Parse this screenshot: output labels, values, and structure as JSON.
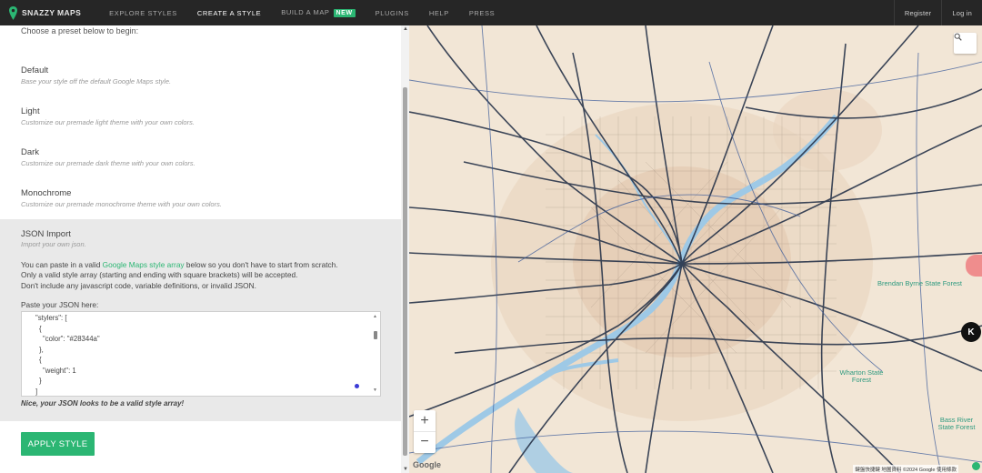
{
  "nav": {
    "brand": "SNAZZY MAPS",
    "items": [
      {
        "label": "EXPLORE STYLES"
      },
      {
        "label": "CREATE A STYLE"
      },
      {
        "label": "BUILD A MAP",
        "badge": "NEW"
      },
      {
        "label": "PLUGINS"
      },
      {
        "label": "HELP"
      },
      {
        "label": "PRESS"
      }
    ],
    "register": "Register",
    "login": "Log in"
  },
  "panel": {
    "intro": "Choose a preset below to begin:",
    "presets": [
      {
        "title": "Default",
        "desc": "Base your style off the default Google Maps style."
      },
      {
        "title": "Light",
        "desc": "Customize our premade light theme with your own colors."
      },
      {
        "title": "Dark",
        "desc": "Customize our premade dark theme with your own colors."
      },
      {
        "title": "Monochrome",
        "desc": "Customize our premade monochrome theme with your own colors."
      }
    ],
    "json_import": {
      "title": "JSON Import",
      "desc": "Import your own json.",
      "para_before_link": "You can paste in a valid ",
      "link": "Google Maps style array",
      "para_after_link": " below so you don't have to start from scratch.",
      "para_line2": "Only a valid style array (starting and ending with square brackets) will be accepted.",
      "para_line3": "Don't include any javascript code, variable definitions, or invalid JSON.",
      "paste_label": "Paste your JSON here:",
      "json_lines": [
        "\"stylers\": [",
        "{",
        "\"color\": \"#28344a\"",
        "},",
        "{",
        "\"weight\": 1",
        "}",
        "]"
      ],
      "valid_msg": "Nice, your JSON looks to be a valid style array!"
    },
    "apply_label": "APPLY STYLE"
  },
  "map": {
    "labels": [
      "Brendan Byrne State Forest",
      "Wharton State Forest",
      "Bass River State Forest"
    ],
    "zoom_in": "+",
    "zoom_out": "−",
    "google": "Google",
    "attribution": "鍵盤快捷鍵   地圖資料 ©2024 Google 使用條款",
    "k_button": "K"
  },
  "colors": {
    "accent": "#2bb673",
    "road": "#28344a",
    "land": "#f2e6d6",
    "water": "#9ec9e6",
    "park": "#2e9a7f"
  }
}
